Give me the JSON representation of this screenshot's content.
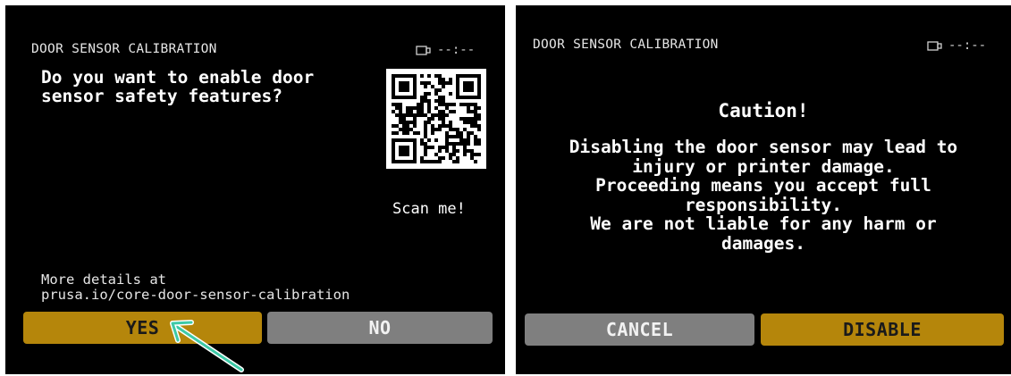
{
  "colors": {
    "screen_bg": "#000000",
    "accent_gold": "#b5860b",
    "button_gray": "#7f7f7f",
    "annotation_arrow": "#3ec9a7"
  },
  "left_screen": {
    "header": {
      "title": "DOOR SENSOR CALIBRATION",
      "status_icon": "usb-drive-icon",
      "time": "--:--"
    },
    "question_lines": [
      "Do you want to enable door",
      "sensor safety features?"
    ],
    "qr": {
      "icon": "qr-code-icon",
      "label": "Scan me!"
    },
    "details_lines": [
      "More details at",
      "prusa.io/core-door-sensor-calibration"
    ],
    "buttons": {
      "yes": "YES",
      "no": "NO"
    }
  },
  "right_screen": {
    "header": {
      "title": "DOOR SENSOR CALIBRATION",
      "status_icon": "usb-drive-icon",
      "time": "--:--"
    },
    "caution_title": "Caution!",
    "caution_lines": [
      "Disabling the door sensor may lead to",
      "injury or printer damage.",
      "Proceeding means you accept full",
      "responsibility.",
      "We are not liable for any harm or",
      "damages."
    ],
    "buttons": {
      "cancel": "CANCEL",
      "disable": "DISABLE"
    }
  }
}
